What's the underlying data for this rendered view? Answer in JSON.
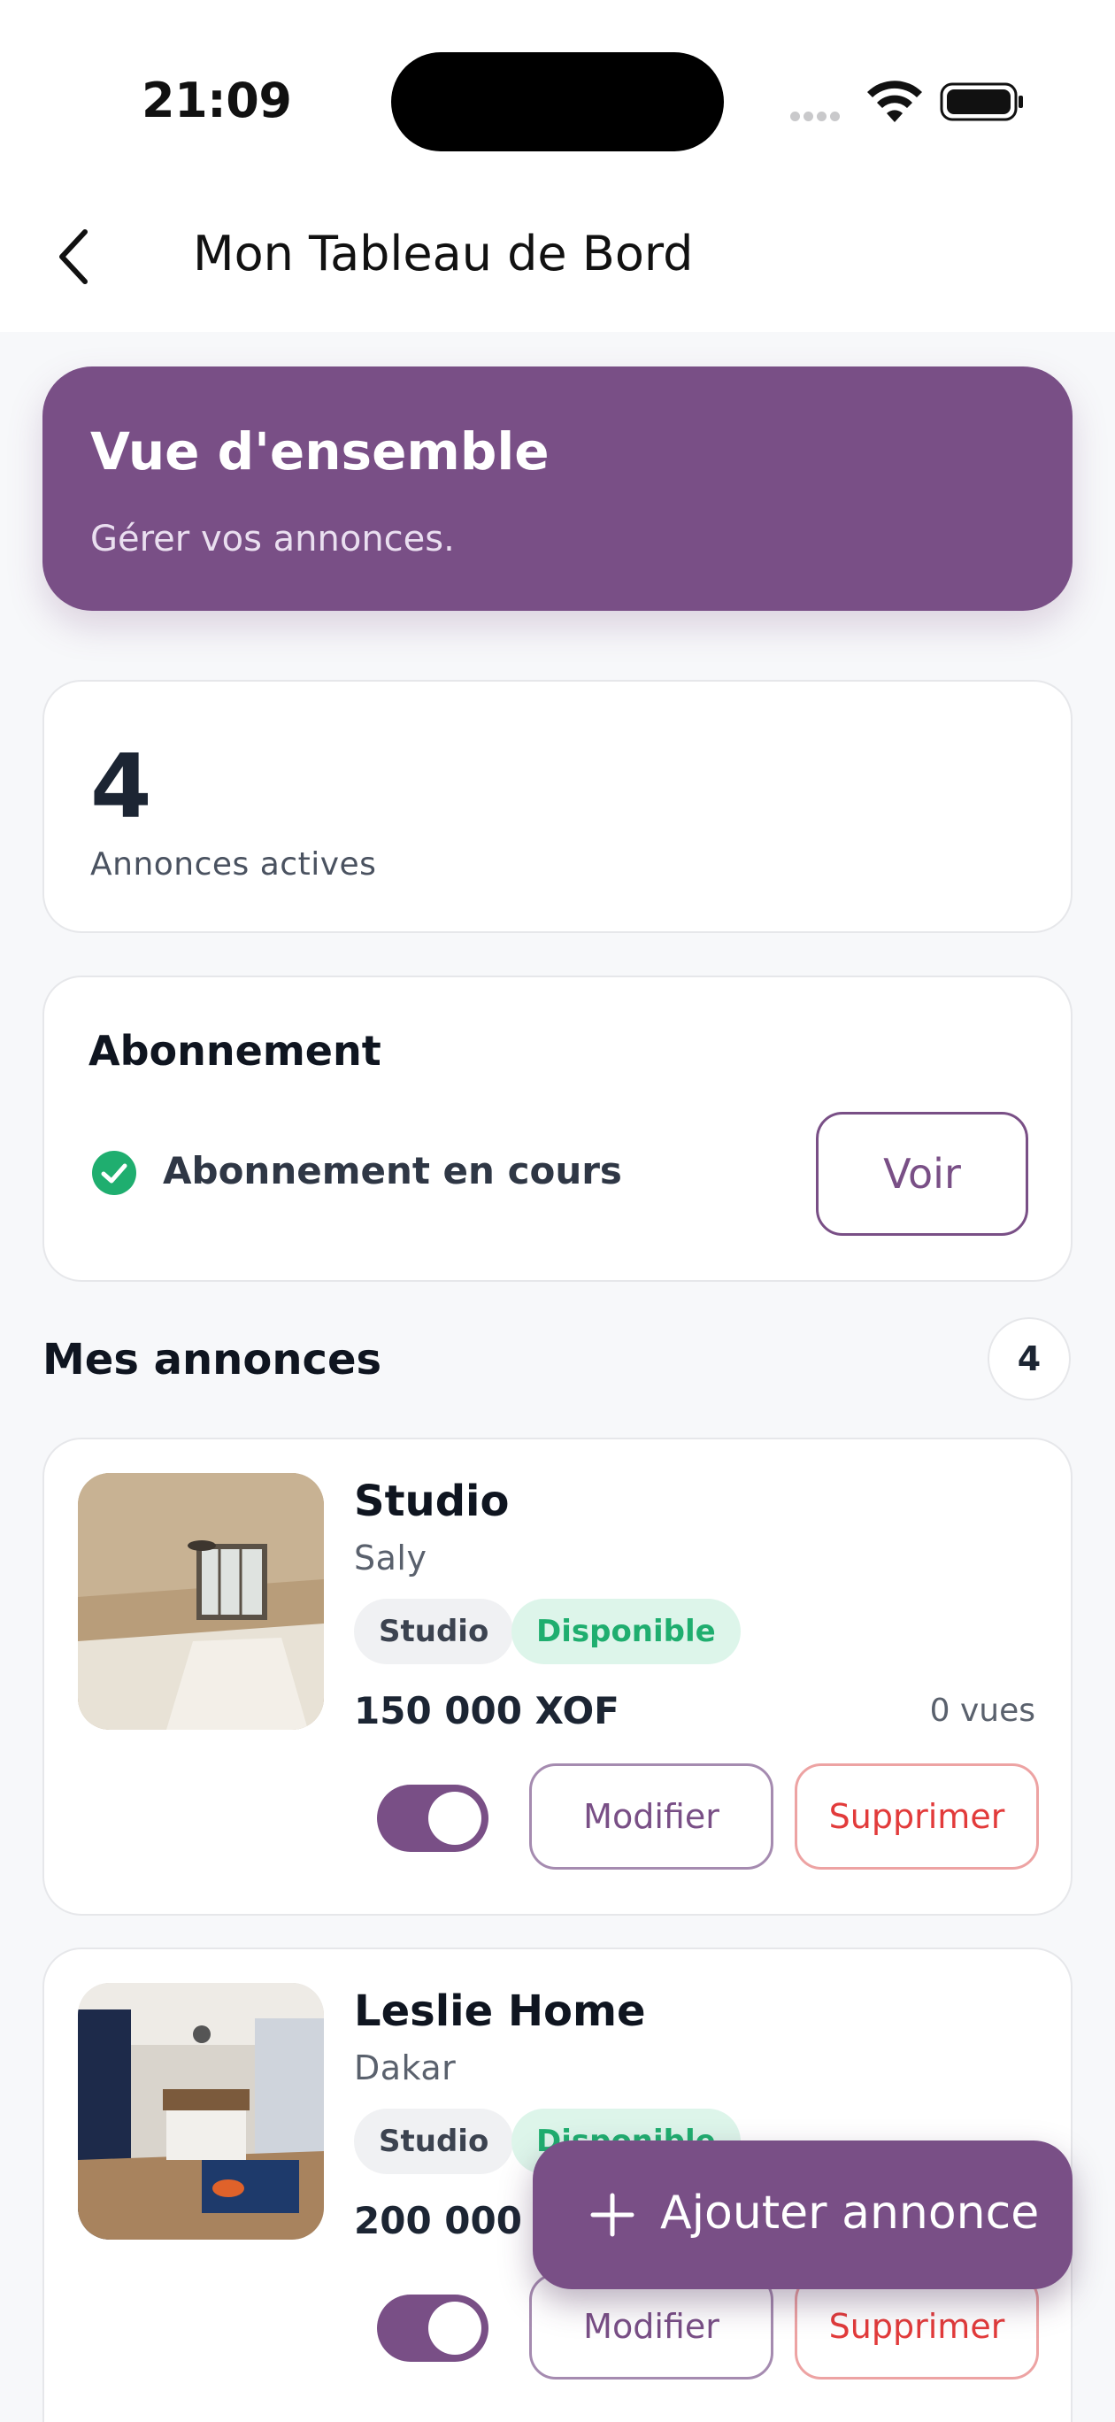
{
  "status_bar": {
    "time": "21:09"
  },
  "nav": {
    "title": "Mon Tableau de Bord"
  },
  "hero": {
    "title": "Vue d'ensemble",
    "subtitle": "Gérer vos annonces."
  },
  "stats": {
    "active_count": "4",
    "active_label": "Annonces actives"
  },
  "subscription": {
    "title": "Abonnement",
    "status": "Abonnement en cours",
    "view_label": "Voir"
  },
  "listings_section": {
    "title": "Mes annonces",
    "count": "4"
  },
  "listings": [
    {
      "title": "Studio",
      "location": "Saly",
      "type": "Studio",
      "status": "Disponible",
      "price": "150 000 XOF",
      "views": "0 vues",
      "active": true,
      "edit_label": "Modifier",
      "delete_label": "Supprimer"
    },
    {
      "title": "Leslie Home",
      "location": "Dakar",
      "type": "Studio",
      "status": "Disponible",
      "price": "200 000 XOF",
      "views": "",
      "active": true,
      "edit_label": "Modifier",
      "delete_label": "Supprimer"
    }
  ],
  "fab": {
    "label": "Ajouter annonce"
  },
  "colors": {
    "primary": "#794f86",
    "success": "#1fae6f",
    "danger": "#e23b3b"
  }
}
